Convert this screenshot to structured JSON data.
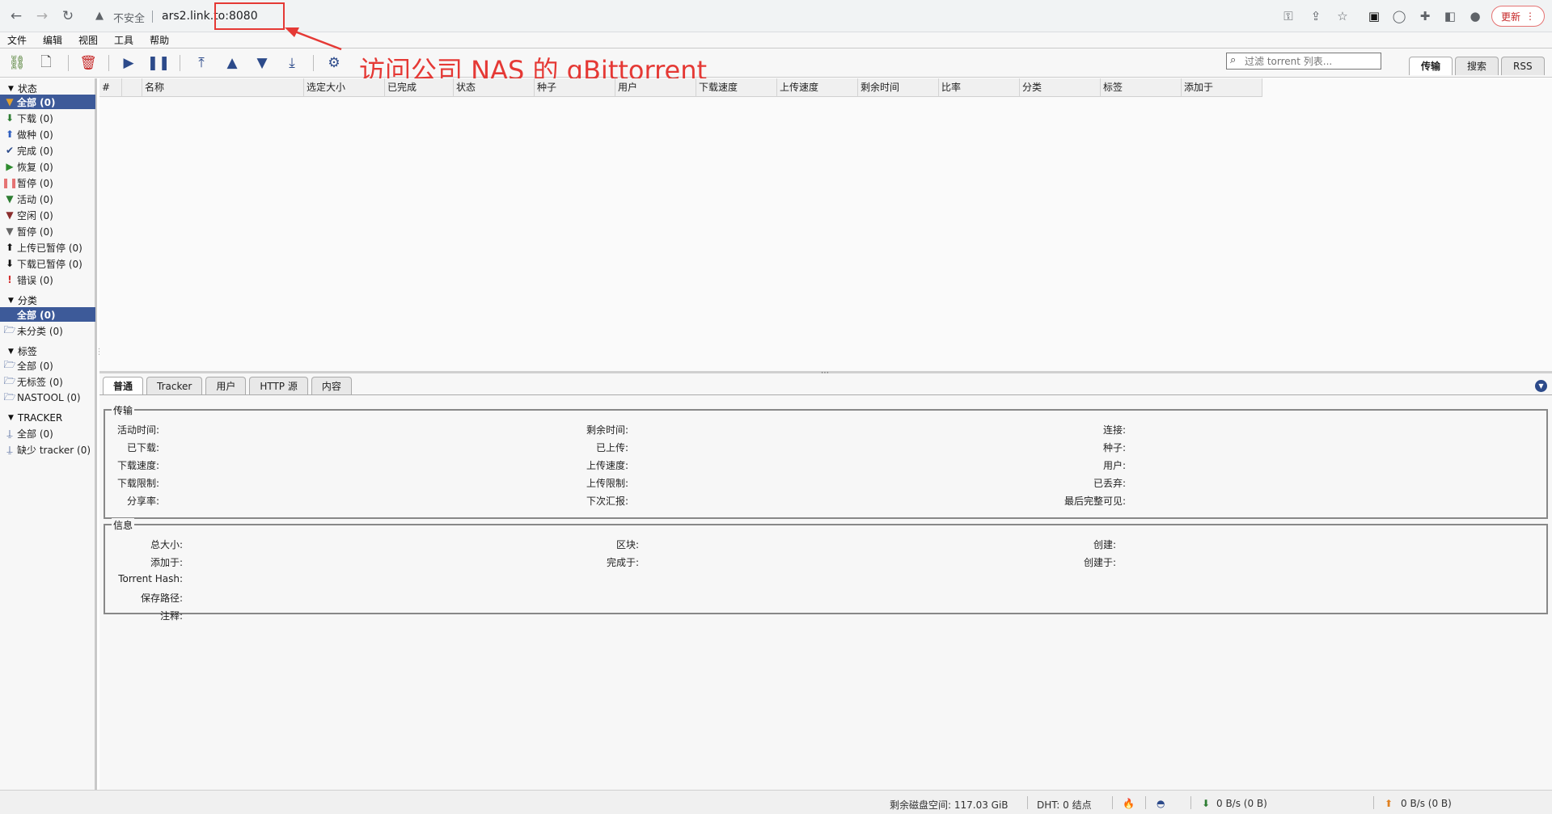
{
  "browser": {
    "insecure_label": "不安全",
    "url": "ars2.link.to:8080",
    "update_label": "更新"
  },
  "menu": [
    "文件",
    "编辑",
    "视图",
    "工具",
    "帮助"
  ],
  "search": {
    "placeholder": "过滤 torrent 列表..."
  },
  "right_tabs": [
    "传输",
    "搜索",
    "RSS"
  ],
  "annotation": "访问公司 NAS 的 qBittorrent",
  "sidebar": {
    "status_header": "状态",
    "status_items": [
      {
        "label": "全部 (0)",
        "icon": "filter-icon"
      },
      {
        "label": "下载 (0)",
        "icon": "download-arrow-icon"
      },
      {
        "label": "做种 (0)",
        "icon": "upload-arrow-icon"
      },
      {
        "label": "完成 (0)",
        "icon": "checkmark-icon"
      },
      {
        "label": "恢复 (0)",
        "icon": "play-icon"
      },
      {
        "label": "暂停 (0)",
        "icon": "pause-icon"
      },
      {
        "label": "活动 (0)",
        "icon": "filter-icon"
      },
      {
        "label": "空闲 (0)",
        "icon": "filter-icon"
      },
      {
        "label": "暂停 (0)",
        "icon": "filter-icon"
      },
      {
        "label": "上传已暂停 (0)",
        "icon": "upload-paused-icon"
      },
      {
        "label": "下载已暂停 (0)",
        "icon": "download-paused-icon"
      },
      {
        "label": "错误 (0)",
        "icon": "error-icon"
      }
    ],
    "category_header": "分类",
    "category_items": [
      {
        "label": "全部 (0)"
      },
      {
        "label": "未分类 (0)",
        "icon": "folder-icon"
      }
    ],
    "tags_header": "标签",
    "tag_items": [
      {
        "label": "全部 (0)",
        "icon": "folder-icon"
      },
      {
        "label": "无标签 (0)",
        "icon": "folder-icon"
      },
      {
        "label": "NASTOOL (0)",
        "icon": "folder-icon"
      }
    ],
    "tracker_header": "TRACKER",
    "tracker_items": [
      {
        "label": "全部 (0)",
        "icon": "tracker-icon"
      },
      {
        "label": "缺少 tracker (0)",
        "icon": "tracker-icon"
      }
    ]
  },
  "table": {
    "columns": [
      "#",
      "",
      "名称",
      "选定大小",
      "已完成",
      "状态",
      "种子",
      "用户",
      "下载速度",
      "上传速度",
      "剩余时间",
      "比率",
      "分类",
      "标签",
      "添加于"
    ]
  },
  "props": {
    "tabs": [
      "普通",
      "Tracker",
      "用户",
      "HTTP 源",
      "内容"
    ],
    "transfer_legend": "传输",
    "transfer_col1": [
      "活动时间:",
      "已下载:",
      "下载速度:",
      "下载限制:",
      "分享率:"
    ],
    "transfer_col2": [
      "剩余时间:",
      "已上传:",
      "上传速度:",
      "上传限制:",
      "下次汇报:"
    ],
    "transfer_col3": [
      "连接:",
      "种子:",
      "用户:",
      "已丢弃:",
      "最后完整可见:"
    ],
    "info_legend": "信息",
    "info_col1": [
      "总大小:",
      "添加于:",
      "Torrent Hash:",
      "保存路径:",
      "注释:"
    ],
    "info_col2": [
      "区块:",
      "完成于:"
    ],
    "info_col3": [
      "创建:",
      "创建于:"
    ]
  },
  "statusbar": {
    "free_space": "剩余磁盘空间: 117.03 GiB",
    "dht": "DHT: 0 结点",
    "download": "0 B/s (0 B)",
    "upload": "0 B/s (0 B)"
  },
  "colors": {
    "selection": "#3d5a99",
    "annotation": "#e53935"
  }
}
